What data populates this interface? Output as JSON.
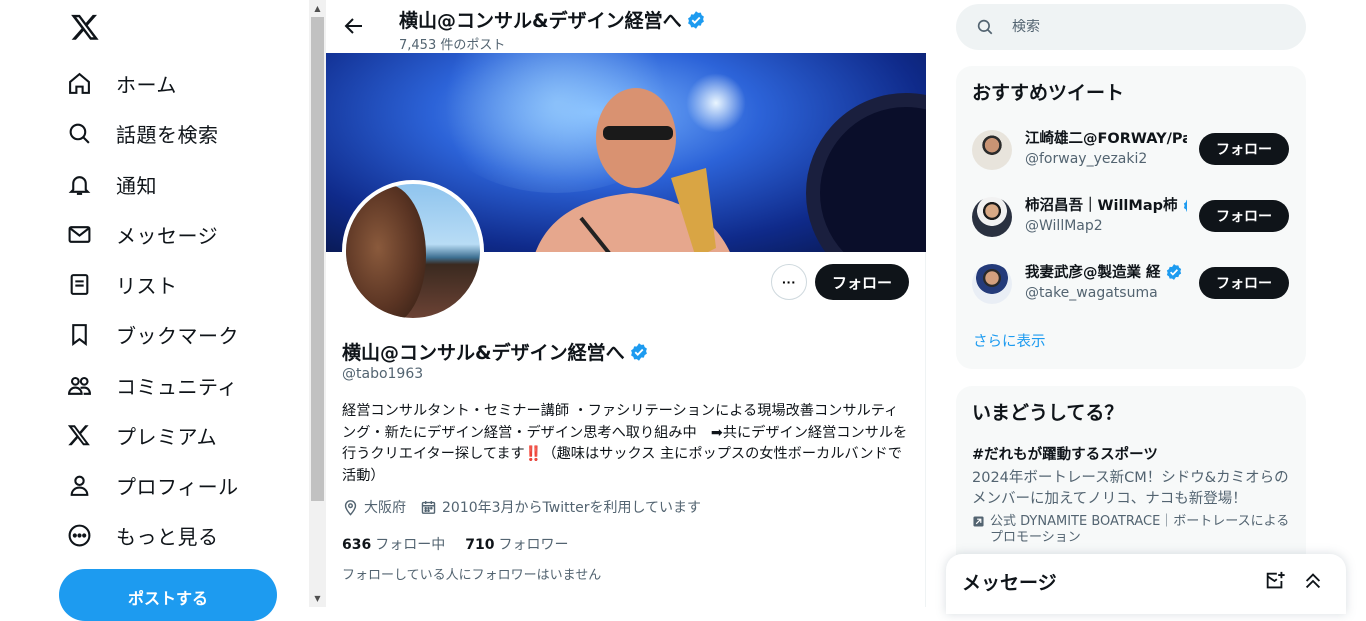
{
  "nav": {
    "items": [
      {
        "label": "ホーム",
        "icon": "home-icon"
      },
      {
        "label": "話題を検索",
        "icon": "search-icon"
      },
      {
        "label": "通知",
        "icon": "bell-icon"
      },
      {
        "label": "メッセージ",
        "icon": "envelope-icon"
      },
      {
        "label": "リスト",
        "icon": "list-icon"
      },
      {
        "label": "ブックマーク",
        "icon": "bookmark-icon"
      },
      {
        "label": "コミュニティ",
        "icon": "people-icon"
      },
      {
        "label": "プレミアム",
        "icon": "x-icon"
      },
      {
        "label": "プロフィール",
        "icon": "person-icon"
      },
      {
        "label": "もっと見る",
        "icon": "more-circle-icon"
      }
    ],
    "post_label": "ポストする"
  },
  "header": {
    "name": "横山@コンサル&デザイン経営へ",
    "post_count": "7,453 件のポスト"
  },
  "profile": {
    "name": "横山@コンサル&デザイン経営へ",
    "handle": "@tabo1963",
    "follow_label": "フォロー",
    "more_label": "···",
    "bio": "経営コンサルタント・セミナー講師 ・ファシリテーションによる現場改善コンサルティング・新たにデザイン経営・デザイン思考へ取り組み中　➡共にデザイン経営コンサルを行うクリエイター探してます‼️（趣味はサックス 主にポップスの女性ボーカルバンドで活動）",
    "location": "大阪府",
    "joined": "2010年3月からTwitterを利用しています",
    "following_count": "636",
    "following_label": "フォロー中",
    "followers_count": "710",
    "followers_label": "フォロワー",
    "mutual_note": "フォローしている人にフォロワーはいません"
  },
  "search": {
    "placeholder": "検索"
  },
  "recommend": {
    "title": "おすすめツイート",
    "users": [
      {
        "name": "江崎雄二@FORWAY/Pan",
        "handle": "@forway_yezaki2",
        "verified": false,
        "follow": "フォロー"
      },
      {
        "name": "柿沼昌吾｜WillMap杮",
        "handle": "@WillMap2",
        "verified": true,
        "follow": "フォロー"
      },
      {
        "name": "我妻武彦@製造業 経",
        "handle": "@take_wagatsuma",
        "verified": true,
        "follow": "フォロー"
      }
    ],
    "show_more": "さらに表示"
  },
  "trends": {
    "title": "いまどうしてる？",
    "item": {
      "hashtag": "#だれもが躍動するスポーツ",
      "desc": "2024年ボートレース新CM！シドウ&カミオらのメンバーに加えてノリコ、ナコも新登場！",
      "promo": "公式 DYNAMITE BOATRACE｜ボートレースによるプロモーション"
    }
  },
  "messages_drawer": {
    "title": "メッセージ"
  },
  "colors": {
    "accent": "#1d9bf0",
    "text": "#0f1419",
    "muted": "#536471",
    "card_bg": "#f7f9f9"
  }
}
